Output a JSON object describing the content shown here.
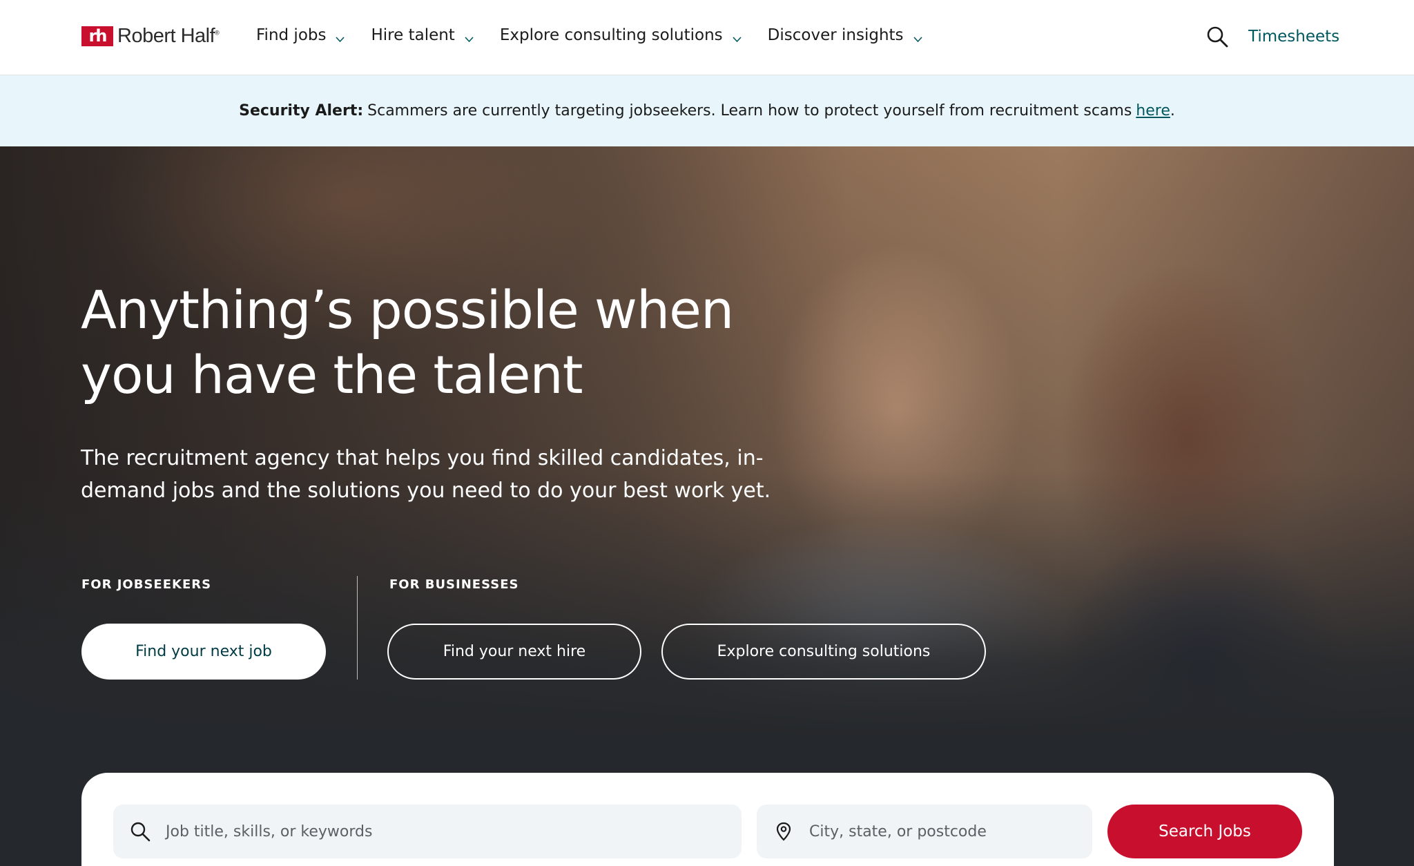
{
  "brand": {
    "logo_mark": "rh",
    "name": "Robert Half",
    "reg": "®"
  },
  "nav": {
    "items": [
      {
        "label": "Find jobs"
      },
      {
        "label": "Hire talent"
      },
      {
        "label": "Explore consulting solutions"
      },
      {
        "label": "Discover insights"
      }
    ],
    "timesheets": "Timesheets"
  },
  "alert": {
    "strong": "Security Alert:",
    "text": "Scammers are currently targeting jobseekers. Learn how to protect yourself from recruitment scams",
    "link": "here",
    "suffix": "."
  },
  "hero": {
    "title": "Anything’s possible when you have the talent",
    "subtitle": "The recruitment agency that helps you find skilled candidates, in-demand jobs and the solutions you need to do your best work yet.",
    "jobseekers_label": "FOR JOBSEEKERS",
    "businesses_label": "FOR BUSINESSES",
    "cta_job": "Find your next job",
    "cta_hire": "Find your next hire",
    "cta_consulting": "Explore consulting solutions"
  },
  "search": {
    "keyword_placeholder": "Job title, skills, or keywords",
    "location_placeholder": "City, state, or postcode",
    "button": "Search Jobs"
  },
  "colors": {
    "brand_red": "#c8102e",
    "teal": "#00585f",
    "alert_bg": "#e8f6fb",
    "hero_dark": "#25282c"
  },
  "icons": {
    "search": "search-icon",
    "chevron": "chevron-down-icon",
    "location": "location-pin-icon"
  }
}
